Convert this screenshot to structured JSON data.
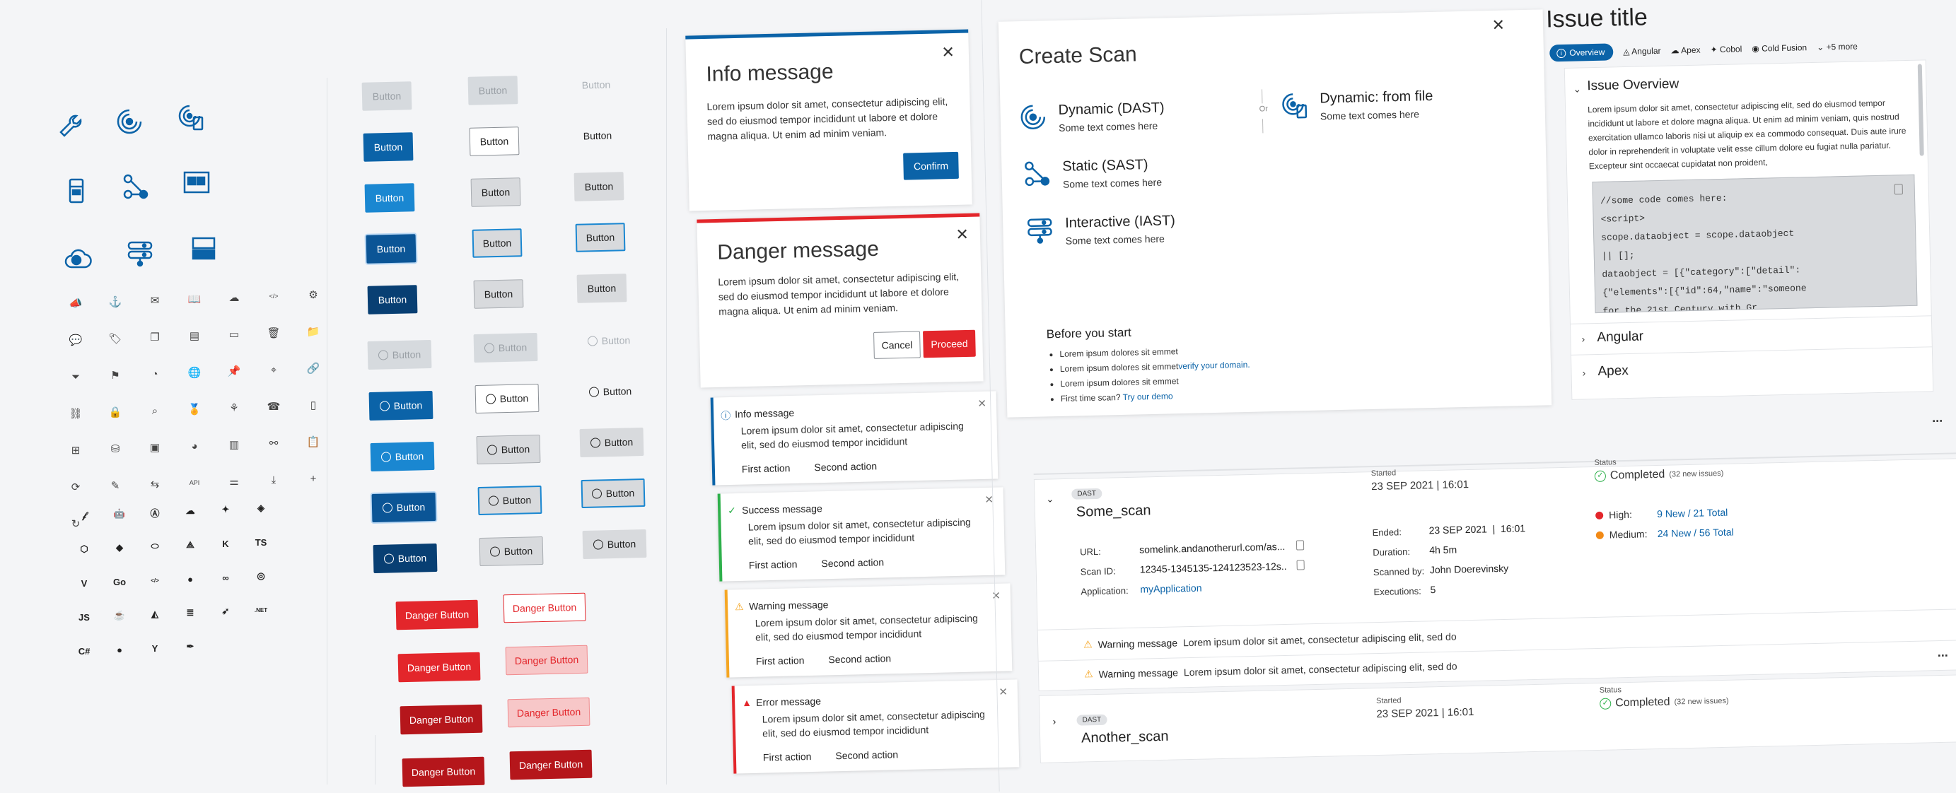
{
  "colors": {
    "primary": "#0b63a8",
    "danger": "#e3262b",
    "success": "#2eb04b",
    "warning": "#f5a623",
    "error": "#e3262b",
    "info": "#0b63a8",
    "critical": "#e3262b",
    "medium": "#f28a16"
  },
  "icons": {
    "large": [
      "wrench-icon",
      "radar-scan-icon",
      "radar-mobile-scan-icon",
      "mobile-device-icon",
      "pipeline-icon",
      "dashboard-window-icon",
      "cloud-icon",
      "server-stack-icon",
      "monitor-stack-icon"
    ],
    "small": [
      "megaphone-icon",
      "anchor-icon",
      "envelope-icon",
      "book-icon",
      "cloud-icon",
      "code-icon",
      "gear-icon",
      "chat-icon",
      "tag-icon",
      "copy-icon",
      "storage-icon",
      "document-icon",
      "trash-icon",
      "folder-icon",
      "filter-icon",
      "flag-icon",
      "compass-icon",
      "globe-icon",
      "pin-icon",
      "target-icon",
      "link-icon",
      "link-chain-icon",
      "lock-icon",
      "search-icon",
      "award-icon",
      "share-network-icon",
      "phone-icon",
      "tablet-icon",
      "sitemap-icon",
      "database-icon",
      "settings-doc-icon",
      "gauge-icon",
      "server-icon",
      "graph-icon",
      "clipboard-icon",
      "refresh-icon",
      "pencil-icon",
      "share-icon",
      "api-icon",
      "sliders-icon",
      "download-icon",
      "plus-icon",
      "sync-icon"
    ],
    "brands": [
      "apache-icon",
      "android-icon",
      "angular-icon",
      "apex-icon",
      "cobol-icon",
      "coldfusion-icon",
      "nodejs-icon",
      "dart-icon",
      "elixir-icon",
      "flutter-icon",
      "kotlin-icon",
      "typescript-icon",
      "vue-icon",
      "golang-icon",
      "html-icon",
      "github-icon",
      "infinity-icon",
      "target-icon",
      "javascript-icon",
      "java-icon",
      "terraform-icon",
      "stack-icon",
      "swift-icon",
      "dotnet-icon",
      "csharp-icon",
      "circle-icon",
      "yaml-icon",
      "pen-icon"
    ]
  },
  "buttons": {
    "label": "Button",
    "danger_label": "Danger Button"
  },
  "info_modal": {
    "title": "Info message",
    "body": "Lorem ipsum dolor sit amet, consectetur adipiscing elit, sed do eiusmod tempor incididunt ut labore et dolore magna aliqua. Ut enim ad minim veniam.",
    "confirm": "Confirm"
  },
  "danger_modal": {
    "title": "Danger message",
    "body": "Lorem ipsum dolor sit amet, consectetur adipiscing elit, sed do eiusmod tempor incididunt ut labore et dolore magna aliqua. Ut enim ad minim veniam.",
    "cancel": "Cancel",
    "proceed": "Proceed"
  },
  "toasts": [
    {
      "title": "Info message",
      "body": "Lorem ipsum dolor sit amet, consectetur adipiscing elit, sed do eiusmod tempor incididunt",
      "a1": "First action",
      "a2": "Second action"
    },
    {
      "title": "Success message",
      "body": "Lorem ipsum dolor sit amet, consectetur adipiscing elit, sed do eiusmod tempor incididunt",
      "a1": "First action",
      "a2": "Second action"
    },
    {
      "title": "Warning message",
      "body": "Lorem ipsum dolor sit amet, consectetur adipiscing elit, sed do eiusmod tempor incididunt",
      "a1": "First action",
      "a2": "Second action"
    },
    {
      "title": "Error message",
      "body": "Lorem ipsum dolor sit amet, consectetur adipiscing elit, sed do eiusmod tempor incididunt",
      "a1": "First action",
      "a2": "Second action"
    }
  ],
  "create_scan": {
    "title": "Create Scan",
    "options": [
      {
        "title": "Dynamic (DAST)",
        "sub": "Some text comes here"
      },
      {
        "title": "Dynamic: from file",
        "sub": "Some text comes here"
      },
      {
        "title": "Static (SAST)",
        "sub": "Some text comes here"
      },
      {
        "title": "Interactive (IAST)",
        "sub": "Some text comes here"
      }
    ],
    "or": "Or",
    "before_title": "Before you start",
    "bullets": [
      "Lorem ipsum dolores sit emmet",
      "Lorem ipsum dolores sit emmet",
      "Lorem ipsum dolores sit emmet",
      "First time scan?"
    ],
    "bullet2_link": "verify your domain.",
    "bullet4_link": "Try our demo"
  },
  "issue": {
    "title": "Issue title",
    "tabs": [
      "Overview",
      "Angular",
      "Apex",
      "Cobol",
      "Cold Fusion",
      "+5 more"
    ],
    "overview_title": "Issue Overview",
    "overview_body": "Lorem ipsum dolor sit amet, consectetur adipiscing elit, sed do eiusmod tempor incididunt ut labore et dolore magna aliqua. Ut enim ad minim veniam, quis nostrud exercitation ullamco laboris nisi ut aliquip ex ea commodo consequat. Duis aute irure dolor in reprehenderit in voluptate velit esse cillum dolore eu fugiat nulla pariatur. Excepteur sint occaecat cupidatat non proident,",
    "code": [
      "//some code comes here:",
      "<script>",
      "scope.dataobject = scope.dataobject",
      "|| [];",
      "dataobject = [{\"category\":[\"detail\":",
      "{\"elements\":[{\"id\":64,\"name\":\"someone",
      "for the 21st Century with Gr"
    ],
    "sections": [
      "Angular",
      "Apex"
    ]
  },
  "scans": [
    {
      "tag": "DAST",
      "name": "Some_scan",
      "started_label": "Started",
      "started": "23 SEP 2021 | 16:01",
      "status_label": "Status",
      "status": "Completed",
      "new_issues": "(32 new issues)",
      "url_label": "URL:",
      "url": "somelink.andanotherurl.com/as...",
      "scanid_label": "Scan ID:",
      "scanid": "12345-1345135-124123523-12s..",
      "app_label": "Application:",
      "app": "myApplication",
      "ended_label": "Ended:",
      "ended": "23 SEP 2021  |  16:01",
      "duration_label": "Duration:",
      "duration": "4h 5m",
      "scannedby_label": "Scanned by:",
      "scannedby": "John Doerevinsky",
      "executions_label": "Executions:",
      "executions": "5",
      "high_label": "High:",
      "high": "9 New / 21 Total",
      "medium_label": "Medium:",
      "medium": "24 New / 56 Total",
      "warnings": [
        {
          "label": "Warning message",
          "text": "Lorem ipsum dolor sit amet, consectetur adipiscing elit, sed do"
        },
        {
          "label": "Warning message",
          "text": "Lorem ipsum dolor sit amet, consectetur adipiscing elit, sed do"
        }
      ]
    },
    {
      "tag": "DAST",
      "name": "Another_scan",
      "started_label": "Started",
      "started": "23 SEP 2021 | 16:01",
      "status_label": "Status",
      "status": "Completed",
      "new_issues": "(32 new issues)"
    }
  ],
  "more": "..."
}
